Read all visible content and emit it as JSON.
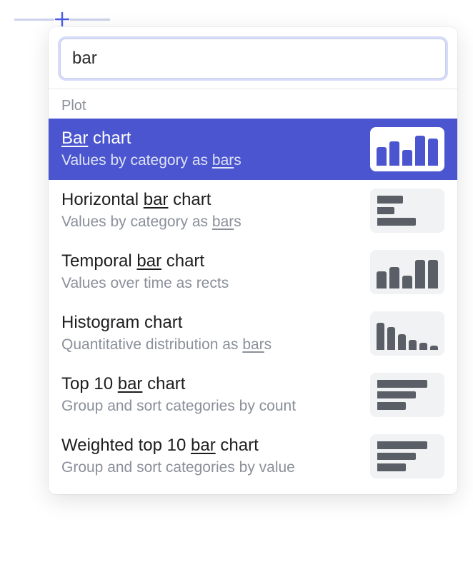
{
  "search": {
    "value": "bar"
  },
  "section": {
    "label": "Plot"
  },
  "items": [
    {
      "title_pre_match": "",
      "title_match": "Bar",
      "title_post_match": " chart",
      "desc_pre_match": "Values by category as ",
      "desc_match": "bar",
      "desc_post_match": "s",
      "selected": true,
      "thumb": "vbars1"
    },
    {
      "title_pre_match": "Horizontal ",
      "title_match": "bar",
      "title_post_match": " chart",
      "desc_pre_match": "Values by category as ",
      "desc_match": "bar",
      "desc_post_match": "s",
      "selected": false,
      "thumb": "hbars1"
    },
    {
      "title_pre_match": "Temporal ",
      "title_match": "bar",
      "title_post_match": " chart",
      "desc_pre_match": "Values over time as rects",
      "desc_match": "",
      "desc_post_match": "",
      "selected": false,
      "thumb": "vbars2"
    },
    {
      "title_pre_match": "Histogram chart",
      "title_match": "",
      "title_post_match": "",
      "desc_pre_match": "Quantitative distribution as ",
      "desc_match": "bar",
      "desc_post_match": "s",
      "selected": false,
      "thumb": "histo"
    },
    {
      "title_pre_match": "Top 10 ",
      "title_match": "bar",
      "title_post_match": " chart",
      "desc_pre_match": "Group and sort categories by count",
      "desc_match": "",
      "desc_post_match": "",
      "selected": false,
      "thumb": "hbars2"
    },
    {
      "title_pre_match": "Weighted top 10 ",
      "title_match": "bar",
      "title_post_match": " chart",
      "desc_pre_match": "Group and sort categories by value",
      "desc_match": "",
      "desc_post_match": "",
      "selected": false,
      "thumb": "hbars3"
    }
  ]
}
